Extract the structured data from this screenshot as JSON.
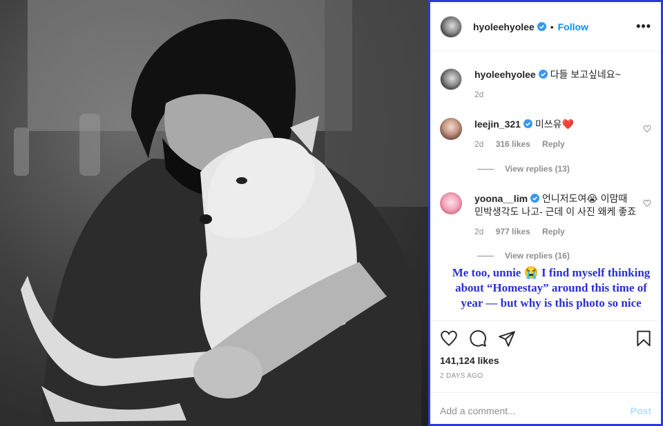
{
  "photo": {
    "description_icon": "photo"
  },
  "header": {
    "username": "hyoleehyolee",
    "separator": "•",
    "follow_label": "Follow",
    "more_label": "•••"
  },
  "caption": {
    "username": "hyoleehyolee",
    "text": "다들 보고싶네요~",
    "time": "2d"
  },
  "comments": [
    {
      "username": "leejin_321",
      "text": "미쓰유❤️",
      "time": "2d",
      "likes": "316 likes",
      "reply_label": "Reply",
      "view_replies": "View replies (13)"
    },
    {
      "username": "yoona__lim",
      "text": "언니저도여😭 이맘때 민박생각도 나고- 근데 이 사진 왜케 좋죠",
      "time": "2d",
      "likes": "977 likes",
      "reply_label": "Reply",
      "view_replies": "View replies (16)"
    }
  ],
  "translation": "Me too, unnie 😭  I find myself thinking about “Homestay” around this time of year — but why is this photo so nice",
  "actions": {
    "likes": "141,124 likes",
    "date": "2 DAYS AGO"
  },
  "add_comment": {
    "placeholder": "Add a comment...",
    "post_label": "Post"
  },
  "colors": {
    "accent": "#0095f6",
    "translation": "#2a2fd6",
    "panel_border": "#2e39d8"
  }
}
